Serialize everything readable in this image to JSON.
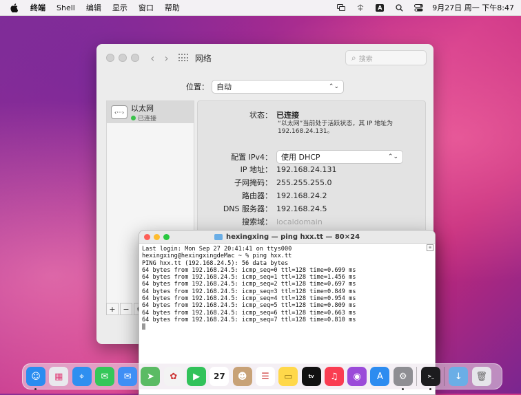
{
  "menubar": {
    "apple_icon": "apple-logo-icon",
    "app_name": "终端",
    "menus": [
      "Shell",
      "编辑",
      "显示",
      "窗口",
      "帮助"
    ],
    "status_icons": [
      "screen-mirroring-icon",
      "wifi-icon",
      "input-method-icon",
      "spotlight-search-icon",
      "control-center-icon"
    ],
    "input_method_label": "A",
    "clock": "9月27日 周一 下午8:47"
  },
  "network_window": {
    "title": "网络",
    "search_placeholder": "搜索",
    "location_label": "位置：",
    "location_value": "自动",
    "sidebar_items": [
      {
        "name": "以太网",
        "status": "已连接",
        "icon": "ethernet-icon",
        "icon_glyph": "‹···›"
      }
    ],
    "sidebar_buttons": [
      "+",
      "−",
      "⚙"
    ],
    "detail": {
      "status_label": "状态：",
      "status_value": "已连接",
      "status_desc": "“以太网”当前处于活跃状态，其 IP 地址为 192.168.24.131。",
      "ipv4_label": "配置 IPv4：",
      "ipv4_value": "使用 DHCP",
      "ip_label": "IP 地址：",
      "ip_value": "192.168.24.131",
      "mask_label": "子网掩码：",
      "mask_value": "255.255.255.0",
      "router_label": "路由器：",
      "router_value": "192.168.24.2",
      "dns_label": "DNS 服务器：",
      "dns_value": "192.168.24.5",
      "search_domain_label": "搜索域：",
      "search_domain_value": "localdomain"
    }
  },
  "terminal": {
    "title": "hexingxing — ping hxx.tt — 80×24",
    "lines": [
      "Last login: Mon Sep 27 20:41:41 on ttys000",
      "hexingxing@hexingxingdeMac ~ % ping hxx.tt",
      "PING hxx.tt (192.168.24.5): 56 data bytes",
      "64 bytes from 192.168.24.5: icmp_seq=0 ttl=128 time=0.699 ms",
      "64 bytes from 192.168.24.5: icmp_seq=1 ttl=128 time=1.456 ms",
      "64 bytes from 192.168.24.5: icmp_seq=2 ttl=128 time=0.697 ms",
      "64 bytes from 192.168.24.5: icmp_seq=3 ttl=128 time=0.849 ms",
      "64 bytes from 192.168.24.5: icmp_seq=4 ttl=128 time=0.954 ms",
      "64 bytes from 192.168.24.5: icmp_seq=5 ttl=128 time=0.809 ms",
      "64 bytes from 192.168.24.5: icmp_seq=6 ttl=128 time=0.663 ms",
      "64 bytes from 192.168.24.5: icmp_seq=7 ttl=128 time=0.810 ms"
    ]
  },
  "dock": {
    "apps": [
      {
        "name": "finder",
        "color": "#2a8cf0",
        "glyph": "☺",
        "running": true
      },
      {
        "name": "launchpad",
        "color": "#e9e9ee",
        "glyph": "▦",
        "running": false
      },
      {
        "name": "safari",
        "color": "#2f8ff0",
        "glyph": "⌖",
        "running": false
      },
      {
        "name": "messages",
        "color": "#34c759",
        "glyph": "✉",
        "running": false
      },
      {
        "name": "mail",
        "color": "#3f8ff5",
        "glyph": "✉",
        "running": false
      },
      {
        "name": "maps",
        "color": "#5bbb64",
        "glyph": "➤",
        "running": false
      },
      {
        "name": "photos",
        "color": "#f3f3f3",
        "glyph": "✿",
        "running": false
      },
      {
        "name": "facetime",
        "color": "#32c25a",
        "glyph": "▶",
        "running": false
      },
      {
        "name": "calendar",
        "color": "#ffffff",
        "glyph": "27",
        "running": false
      },
      {
        "name": "contacts",
        "color": "#c8a277",
        "glyph": "☻",
        "running": false
      },
      {
        "name": "reminders",
        "color": "#ffffff",
        "glyph": "☰",
        "running": false
      },
      {
        "name": "notes",
        "color": "#ffd84a",
        "glyph": "▭",
        "running": false
      },
      {
        "name": "apple-tv",
        "color": "#111111",
        "glyph": "tv",
        "running": false
      },
      {
        "name": "music",
        "color": "#fa3d52",
        "glyph": "♫",
        "running": false
      },
      {
        "name": "podcasts",
        "color": "#9b4bd9",
        "glyph": "◉",
        "running": false
      },
      {
        "name": "app-store",
        "color": "#2d8cf0",
        "glyph": "A",
        "running": false
      },
      {
        "name": "system-preferences",
        "color": "#8e8e93",
        "glyph": "⚙",
        "running": true
      },
      {
        "name": "terminal",
        "color": "#1c1c1e",
        "glyph": ">_",
        "running": true
      },
      {
        "name": "downloads-folder",
        "color": "#6aaee6",
        "glyph": "↓",
        "running": false
      },
      {
        "name": "trash",
        "color": "#e5e5ea",
        "glyph": "🗑",
        "running": false
      }
    ]
  }
}
